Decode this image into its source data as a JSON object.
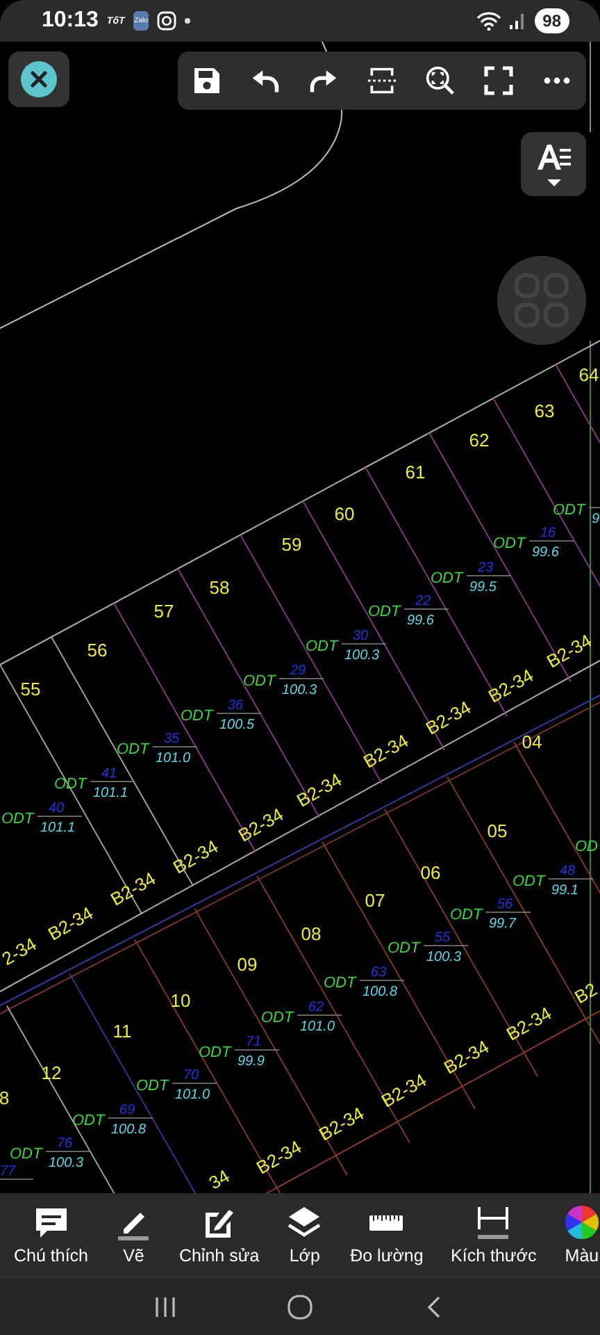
{
  "status_bar": {
    "time": "10:13",
    "notification_label": "TốT",
    "chat_app_label": "Zalo",
    "battery": "98"
  },
  "drawing": {
    "plots": [
      {
        "number": "55"
      },
      {
        "number": "56"
      },
      {
        "number": "57"
      },
      {
        "number": "58"
      },
      {
        "number": "59"
      },
      {
        "number": "60"
      },
      {
        "number": "61"
      },
      {
        "number": "62"
      },
      {
        "number": "63"
      },
      {
        "number": "64"
      },
      {
        "number": "04"
      },
      {
        "number": "05"
      },
      {
        "number": "06"
      },
      {
        "number": "07"
      },
      {
        "number": "08"
      },
      {
        "number": "09"
      },
      {
        "number": "10"
      },
      {
        "number": "11"
      },
      {
        "number": "12"
      },
      {
        "number": "8"
      }
    ],
    "annotations": [
      {
        "use": "ODT",
        "lot": "40",
        "area": "101.1"
      },
      {
        "use": "ODT",
        "lot": "41",
        "area": "101.1"
      },
      {
        "use": "ODT",
        "lot": "35",
        "area": "101.0"
      },
      {
        "use": "ODT",
        "lot": "36",
        "area": "100.5"
      },
      {
        "use": "ODT",
        "lot": "29",
        "area": "100.3"
      },
      {
        "use": "ODT",
        "lot": "30",
        "area": "100.3"
      },
      {
        "use": "ODT",
        "lot": "22",
        "area": "99.6"
      },
      {
        "use": "ODT",
        "lot": "23",
        "area": "99.5"
      },
      {
        "use": "ODT",
        "lot": "16",
        "area": "99.6"
      },
      {
        "use": "ODT",
        "area": "9"
      },
      {
        "use": "ODT",
        "lot": "48",
        "area": "99.1"
      },
      {
        "use": "ODT",
        "lot": "56",
        "area": "99.7"
      },
      {
        "use": "ODT",
        "lot": "55",
        "area": "100.3"
      },
      {
        "use": "ODT",
        "lot": "63",
        "area": "100.8"
      },
      {
        "use": "ODT",
        "lot": "62",
        "area": "101.0"
      },
      {
        "use": "ODT",
        "lot": "71",
        "area": "99.9"
      },
      {
        "use": "ODT",
        "lot": "70",
        "area": "101.0"
      },
      {
        "use": "ODT",
        "lot": "69",
        "area": "100.8"
      },
      {
        "use": "ODT",
        "lot": "76",
        "area": "100.3"
      },
      {
        "use": "OD"
      },
      {
        "lot": "77"
      }
    ],
    "block_codes": [
      "2-34",
      "B2-34",
      "B2-34",
      "B2-34",
      "B2-34",
      "B2-34",
      "B2-34",
      "B2-34",
      "B2-34",
      "B2-34",
      "B2",
      "B2-34",
      "B2-34",
      "B2-34",
      "B2-34",
      "B2-34",
      "34"
    ]
  },
  "bottom_toolbar": [
    {
      "label": "Chú thích"
    },
    {
      "label": "Vẽ"
    },
    {
      "label": "Chỉnh sửa"
    },
    {
      "label": "Lớp"
    },
    {
      "label": "Đo lường"
    },
    {
      "label": "Kích thước"
    },
    {
      "label": "Màu"
    }
  ]
}
